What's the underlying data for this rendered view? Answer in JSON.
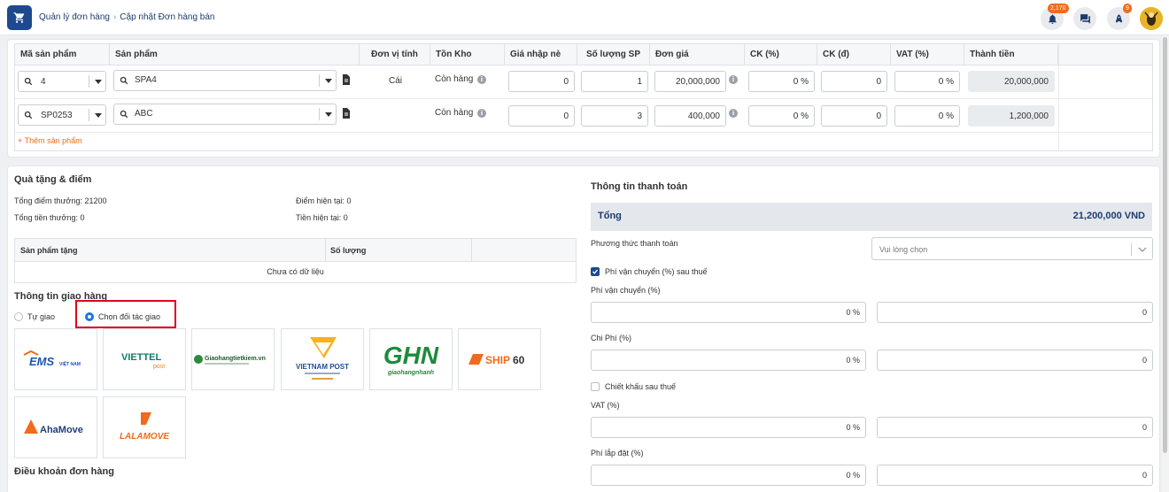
{
  "breadcrumb": {
    "parent": "Quản lý đơn hàng",
    "current": "Cập nhật Đơn hàng bán"
  },
  "header": {
    "notification_count": "2,170",
    "rocket_count": "9"
  },
  "product_table": {
    "columns": [
      "Mã sản phẩm",
      "Sản phẩm",
      "Đơn vị tính",
      "Tồn Kho",
      "Giá nhập nè",
      "Số lượng SP",
      "Đơn giá",
      "CK (%)",
      "CK (đ)",
      "VAT (%)",
      "Thành tiền"
    ],
    "rows": [
      {
        "code": "4",
        "product": "SPA4",
        "unit": "Cái",
        "stock": "Còn hàng",
        "import_price": "0",
        "quantity": "1",
        "unit_price": "20,000,000",
        "discount_pct": "0 %",
        "discount_amt": "0",
        "vat": "0 %",
        "total": "20,000,000"
      },
      {
        "code": "SP0253",
        "product": "ABC",
        "unit": "",
        "stock": "Còn hàng",
        "import_price": "0",
        "quantity": "3",
        "unit_price": "400,000",
        "discount_pct": "0 %",
        "discount_amt": "0",
        "vat": "0 %",
        "total": "1,200,000"
      }
    ],
    "add_product": "+ Thêm sản phẩm"
  },
  "gifts": {
    "title": "Quà tặng & điểm",
    "total_points": "Tổng điểm thưởng: 21200",
    "current_points": "Điểm hiện tại: 0",
    "total_reward": "Tổng tiền thưởng: 0",
    "current_money": "Tiền hiện tại: 0",
    "col_product": "Sản phẩm tặng",
    "col_qty": "Số lượng",
    "empty": "Chưa có dữ liệu"
  },
  "shipping": {
    "title": "Thông tin giao hàng",
    "self_delivery": "Tự giao",
    "choose_partner": "Chọn đối tác giao",
    "partners": [
      "EMS",
      "Viettel Post",
      "Giao hàng tiết kiệm",
      "Vietnam Post",
      "GHN",
      "SHIP60",
      "AhaMove",
      "Lalamove"
    ],
    "ems_sub": "VIỆT NAM",
    "viettel_sub": "post",
    "ghtk_name": "Giaohangtietkiem.vn",
    "vnpost_name": "VIETNAM POST",
    "ghn_sub": "giaohangnhanh",
    "terms_title": "Điều khoản đơn hàng"
  },
  "payment": {
    "title": "Thông tin thanh toán",
    "total_label": "Tổng",
    "total_value": "21,200,000 VND",
    "method_label": "Phương thức thanh toán",
    "method_placeholder": "Vui lòng chọn",
    "shipping_after_tax": "Phí vận chuyển (%) sau thuế",
    "shipping_fee_label": "Phí vận chuyển (%)",
    "shipping_fee_pct": "0 %",
    "shipping_fee_amt": "0",
    "cost_label": "Chi Phí (%)",
    "cost_pct": "0 %",
    "cost_amt": "0",
    "discount_after_tax": "Chiết khấu sau thuế",
    "vat_label": "VAT (%)",
    "vat_pct": "0 %",
    "vat_amt": "0",
    "install_label": "Phí lắp đặt (%)",
    "install_pct": "0 %",
    "install_amt": "0"
  },
  "colors": {
    "brand": "#1d4a8f",
    "accent": "#f26a1b",
    "highlight": "#e0001b"
  }
}
